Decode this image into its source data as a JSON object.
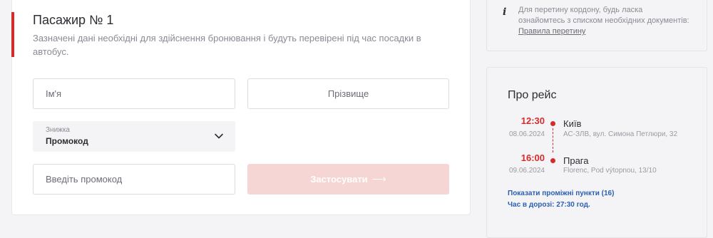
{
  "passenger": {
    "title": "Пасажир № 1",
    "description": "Зазначені дані необхідні для здійснення бронювання і будуть перевірені під час посадки в автобус.",
    "first_name_placeholder": "Ім'я",
    "last_name_placeholder": "Прізвище",
    "discount": {
      "label": "Знижка",
      "value": "Промокод"
    },
    "promo_placeholder": "Введіть промокод",
    "apply_label": "Застосувати"
  },
  "border_info": {
    "text": "Для перетину кордону, будь ласка ознайомтесь з списком необхідних документів:",
    "link": "Правила перетину"
  },
  "trip": {
    "title": "Про рейс",
    "departure": {
      "time": "12:30",
      "date": "08.06.2024",
      "city": "Київ",
      "address": "АС-ЗЛВ, вул. Симона Петлюри, 32"
    },
    "arrival": {
      "time": "16:00",
      "date": "09.06.2024",
      "city": "Прага",
      "address": "Florenc, Pod výtopnou, 13/10"
    },
    "stops_link": "Показати проміжні пункти (16)",
    "duration": "Час в дорозі: 27:30 год."
  },
  "colors": {
    "accent": "#d52b2b",
    "link": "#2a5fb3",
    "button_disabled": "#f6d5d5"
  }
}
